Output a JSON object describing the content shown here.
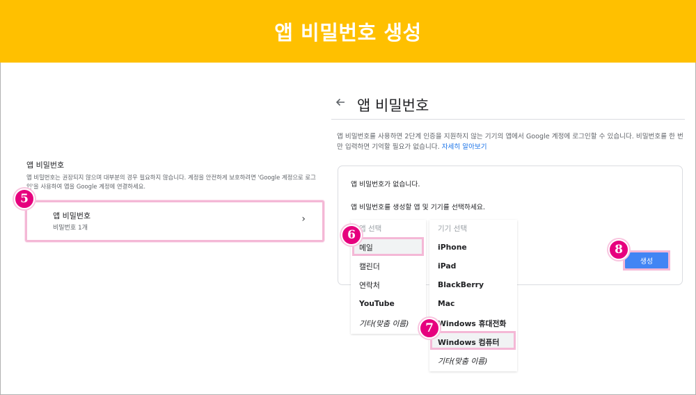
{
  "banner": {
    "title": "앱 비밀번호 생성"
  },
  "left": {
    "title": "앱 비밀번호",
    "description": "앱 비밀번호는 권장되지 않으며 대부분의 경우 필요하지 않습니다. 계정을 안전하게 보호하려면 'Google 계정으로 로그인'을 사용하여 앱을 Google 계정에 연결하세요.",
    "card": {
      "title": "앱 비밀번호",
      "subtitle": "비밀번호 1개",
      "chevron": "›"
    }
  },
  "right": {
    "back_icon": "arrow-left-icon",
    "title": "앱 비밀번호",
    "description": "앱 비밀번호를 사용하면 2단계 인증을 지원하지 않는 기기의 앱에서 Google 계정에 로그인할 수 있습니다. 비밀번호를 한 번만 입력하면 기억할 필요가 없습니다.",
    "learn_more": "자세히 알아보기",
    "empty_text": "앱 비밀번호가 없습니다.",
    "prompt": "앱 비밀번호를 생성할 앱 및 기기를 선택하세요.",
    "app_menu": {
      "header": "앱 선택",
      "items": [
        "메일",
        "캘린더",
        "연락처",
        "YouTube",
        "기타(맞춤 이름)"
      ]
    },
    "device_menu": {
      "header": "기기 선택",
      "items": [
        "iPhone",
        "iPad",
        "BlackBerry",
        "Mac",
        "Windows 휴대전화",
        "Windows 컴퓨터",
        "기타(맞춤 이름)"
      ]
    },
    "create_button": "생성"
  },
  "badges": [
    "5",
    "6",
    "7",
    "8"
  ],
  "colors": {
    "banner": "#ffc000",
    "badge": "#e6007e",
    "highlight": "#f4b8d6",
    "primary_button": "#4285f4",
    "link": "#1a73e8"
  }
}
